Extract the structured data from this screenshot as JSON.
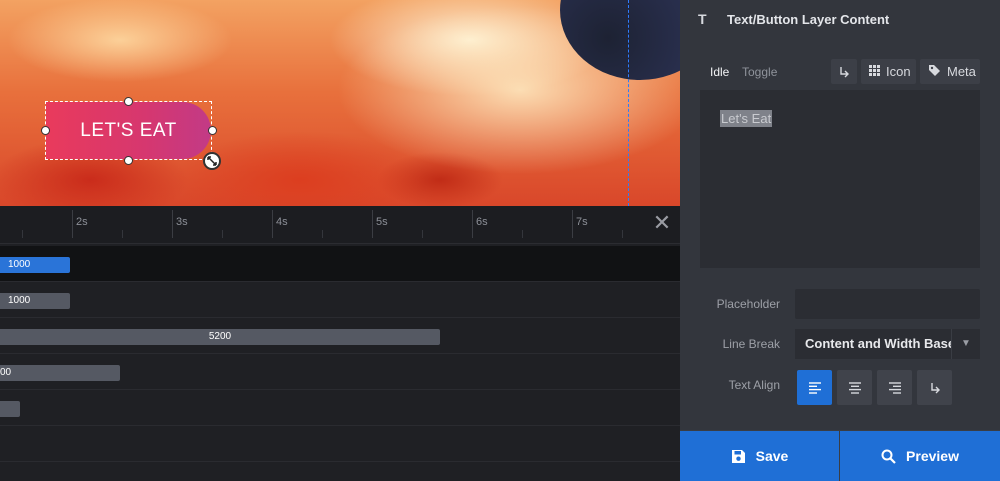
{
  "stage": {
    "layer_label": "LET'S EAT"
  },
  "timeline": {
    "ticks": [
      "2s",
      "3s",
      "4s",
      "5s",
      "6s",
      "7s"
    ],
    "close_icon": "close-icon",
    "rows": [
      {
        "label": "1000",
        "color": "#2a74d8"
      },
      {
        "label": "1000",
        "color": "#555963"
      },
      {
        "label": "5200",
        "color": "#555963"
      },
      {
        "label": "00",
        "color": "#555963"
      },
      {
        "label": "",
        "color": "#555963"
      }
    ]
  },
  "panel": {
    "header_title": "Text/Button Layer Content",
    "header_icon": "text-icon",
    "tabs": {
      "idle": "Idle",
      "toggle": "Toggle"
    },
    "buttons": {
      "linebreak_icon": "return-arrow-icon",
      "icon_label": "Icon",
      "meta_label": "Meta"
    },
    "content_text": "Let's Eat",
    "fields": {
      "placeholder_label": "Placeholder",
      "placeholder_value": "",
      "line_break_label": "Line Break",
      "line_break_value": "Content and Width Based",
      "text_align_label": "Text Align"
    },
    "footer": {
      "save_label": "Save",
      "preview_label": "Preview"
    },
    "accent_color": "#1f6fd6"
  }
}
